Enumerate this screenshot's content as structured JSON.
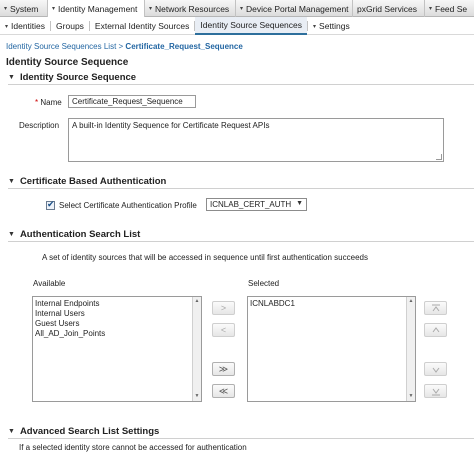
{
  "top_nav": {
    "items": [
      {
        "label": "System",
        "has_arrow": true
      },
      {
        "label": "Identity Management",
        "has_arrow": true,
        "active": true
      },
      {
        "label": "Network Resources",
        "has_arrow": true
      },
      {
        "label": "Device Portal Management",
        "has_arrow": true
      },
      {
        "label": "pxGrid Services",
        "has_arrow": false
      },
      {
        "label": "Feed Se",
        "has_arrow": true
      }
    ]
  },
  "sub_nav": {
    "items": [
      {
        "label": "Identities",
        "has_arrow": true
      },
      {
        "label": "Groups"
      },
      {
        "label": "External Identity Sources"
      },
      {
        "label": "Identity Source Sequences",
        "active": true
      },
      {
        "label": "Settings",
        "has_arrow": true
      }
    ]
  },
  "breadcrumb": {
    "parent": "Identity Source Sequences List",
    "separator": " > ",
    "current": "Certificate_Request_Sequence"
  },
  "page_title": "Identity Source Sequence",
  "identity_section": {
    "header": "Identity Source Sequence",
    "name_label": "Name",
    "required_mark": "*",
    "name_value": "Certificate_Request_Sequence",
    "description_label": "Description",
    "description_value": "A built-in Identity Sequence for Certificate Request APIs"
  },
  "cert_section": {
    "header": "Certificate Based Authentication",
    "checkbox_checked": true,
    "checkbox_label": "Select Certificate Authentication Profile",
    "profile_value": "ICNLAB_CERT_AUTH"
  },
  "search_section": {
    "header": "Authentication Search List",
    "description": "A set of identity sources that will be accessed in sequence until first authentication succeeds",
    "available_label": "Available",
    "selected_label": "Selected",
    "available_items": [
      "Internal Endpoints",
      "Internal Users",
      "Guest Users",
      "All_AD_Join_Points"
    ],
    "selected_items": [
      "ICNLABDC1"
    ],
    "move_right": ">",
    "move_left": "<",
    "move_all_right": "≫",
    "move_all_left": "≪"
  },
  "advanced_section": {
    "header": "Advanced Search List Settings",
    "note": "If a selected identity store cannot be accessed for authentication"
  },
  "icons": {
    "expand": "triangle-down-icon",
    "scroll_up": "scroll-up-icon",
    "scroll_down": "scroll-down-icon",
    "move_top": "move-to-top-icon",
    "move_up": "move-up-icon",
    "move_down": "move-down-icon",
    "move_bottom": "move-to-bottom-icon"
  },
  "colors": {
    "link": "#2467a3",
    "active_tab_underline": "#2d6f9c",
    "checkbox_tick": "#1a4f86"
  }
}
